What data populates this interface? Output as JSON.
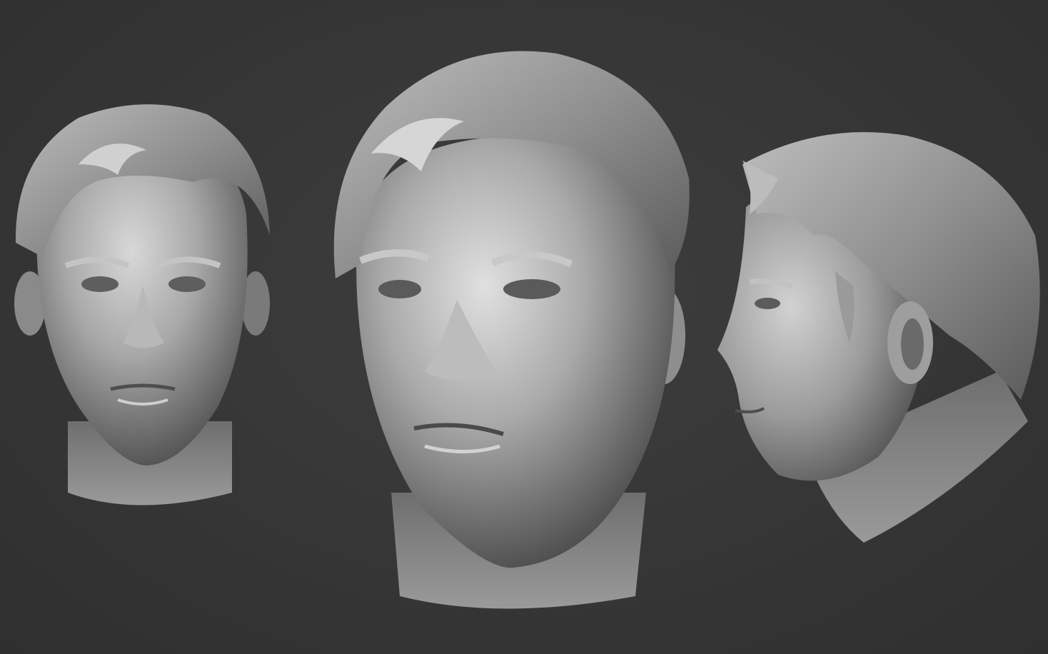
{
  "viewport": {
    "background_color": "#383838",
    "clay_color": "#8c8c8c",
    "highlight_color": "#dcdcdc",
    "shadow_color": "#2a2a2a"
  },
  "sculpts": [
    {
      "name": "front-view"
    },
    {
      "name": "three-quarter-view"
    },
    {
      "name": "side-profile-view"
    }
  ]
}
